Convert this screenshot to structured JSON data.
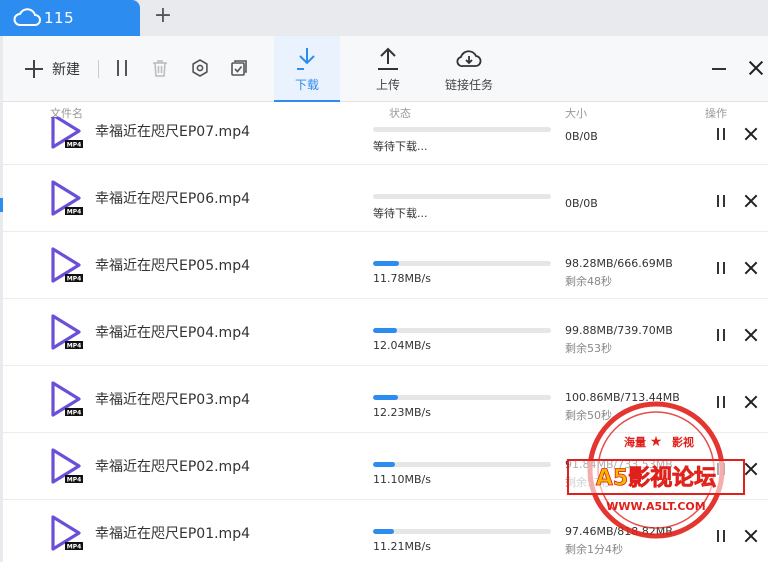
{
  "tab": {
    "label": "115"
  },
  "toolbar": {
    "new_label": "新建",
    "download_label": "下载",
    "upload_label": "上传",
    "link_task_label": "链接任务"
  },
  "columns": {
    "name": "文件名",
    "status": "状态",
    "size": "大小",
    "action": "操作"
  },
  "rows": [
    {
      "name": "幸福近在咫尺EP07.mp4",
      "progress": 0,
      "status": "等待下载...",
      "size": "0B/0B",
      "remain": ""
    },
    {
      "name": "幸福近在咫尺EP06.mp4",
      "progress": 0,
      "status": "等待下载...",
      "size": "0B/0B",
      "remain": ""
    },
    {
      "name": "幸福近在咫尺EP05.mp4",
      "progress": 0.147,
      "status": "11.78MB/s",
      "size": "98.28MB/666.69MB",
      "remain": "剩余48秒"
    },
    {
      "name": "幸福近在咫尺EP04.mp4",
      "progress": 0.135,
      "status": "12.04MB/s",
      "size": "99.88MB/739.70MB",
      "remain": "剩余53秒"
    },
    {
      "name": "幸福近在咫尺EP03.mp4",
      "progress": 0.141,
      "status": "12.23MB/s",
      "size": "100.86MB/713.44MB",
      "remain": "剩余50秒"
    },
    {
      "name": "幸福近在咫尺EP02.mp4",
      "progress": 0.125,
      "status": "11.10MB/s",
      "size": "91.84MB/733.53MB",
      "remain": "剩余57秒"
    },
    {
      "name": "幸福近在咫尺EP01.mp4",
      "progress": 0.119,
      "status": "11.21MB/s",
      "size": "97.46MB/818.82MB",
      "remain": "剩余1分4秒"
    }
  ],
  "watermark": {
    "top": "海量",
    "top2": "影视",
    "main": "A5影视论坛",
    "url": "WWW.A5LT.COM"
  },
  "colors": {
    "accent": "#2d8cf0",
    "icon_purple": "#6b4fd8",
    "stamp_red": "#e0201b"
  }
}
